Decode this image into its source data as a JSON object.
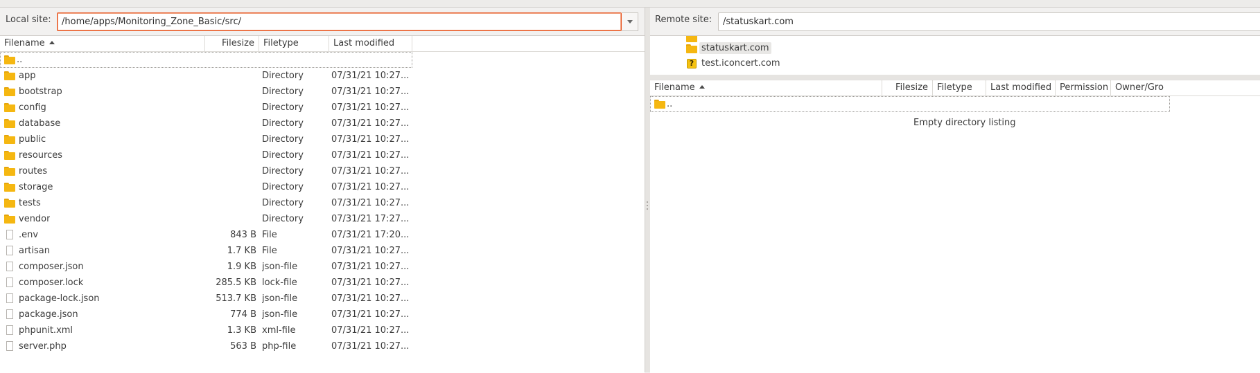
{
  "local": {
    "label": "Local site:",
    "path": "/home/apps/Monitoring_Zone_Basic/src/",
    "columns": [
      "Filename",
      "Filesize",
      "Filetype",
      "Last modified"
    ],
    "parent": "..",
    "rows": [
      {
        "name": "app",
        "size": "",
        "type": "Directory",
        "modified": "07/31/21 10:27...",
        "kind": "folder"
      },
      {
        "name": "bootstrap",
        "size": "",
        "type": "Directory",
        "modified": "07/31/21 10:27...",
        "kind": "folder"
      },
      {
        "name": "config",
        "size": "",
        "type": "Directory",
        "modified": "07/31/21 10:27...",
        "kind": "folder"
      },
      {
        "name": "database",
        "size": "",
        "type": "Directory",
        "modified": "07/31/21 10:27...",
        "kind": "folder"
      },
      {
        "name": "public",
        "size": "",
        "type": "Directory",
        "modified": "07/31/21 10:27...",
        "kind": "folder"
      },
      {
        "name": "resources",
        "size": "",
        "type": "Directory",
        "modified": "07/31/21 10:27...",
        "kind": "folder"
      },
      {
        "name": "routes",
        "size": "",
        "type": "Directory",
        "modified": "07/31/21 10:27...",
        "kind": "folder"
      },
      {
        "name": "storage",
        "size": "",
        "type": "Directory",
        "modified": "07/31/21 10:27...",
        "kind": "folder"
      },
      {
        "name": "tests",
        "size": "",
        "type": "Directory",
        "modified": "07/31/21 10:27...",
        "kind": "folder"
      },
      {
        "name": "vendor",
        "size": "",
        "type": "Directory",
        "modified": "07/31/21 17:27...",
        "kind": "folder"
      },
      {
        "name": ".env",
        "size": "843 B",
        "type": "File",
        "modified": "07/31/21 17:20...",
        "kind": "file"
      },
      {
        "name": "artisan",
        "size": "1.7 KB",
        "type": "File",
        "modified": "07/31/21 10:27...",
        "kind": "file"
      },
      {
        "name": "composer.json",
        "size": "1.9 KB",
        "type": "json-file",
        "modified": "07/31/21 10:27...",
        "kind": "file"
      },
      {
        "name": "composer.lock",
        "size": "285.5 KB",
        "type": "lock-file",
        "modified": "07/31/21 10:27...",
        "kind": "file"
      },
      {
        "name": "package-lock.json",
        "size": "513.7 KB",
        "type": "json-file",
        "modified": "07/31/21 10:27...",
        "kind": "file"
      },
      {
        "name": "package.json",
        "size": "774 B",
        "type": "json-file",
        "modified": "07/31/21 10:27...",
        "kind": "file"
      },
      {
        "name": "phpunit.xml",
        "size": "1.3 KB",
        "type": "xml-file",
        "modified": "07/31/21 10:27...",
        "kind": "file"
      },
      {
        "name": "server.php",
        "size": "563 B",
        "type": "php-file",
        "modified": "07/31/21 10:27...",
        "kind": "file"
      }
    ]
  },
  "remote": {
    "label": "Remote site:",
    "path": "/statuskart.com",
    "tree": [
      {
        "name": "statuskart.com",
        "icon": "folder-icon",
        "selected": true
      },
      {
        "name": "test.iconcert.com",
        "icon": "question-icon",
        "selected": false
      }
    ],
    "columns": [
      "Filename",
      "Filesize",
      "Filetype",
      "Last modified",
      "Permission",
      "Owner/Gro"
    ],
    "parent": "..",
    "empty_message": "Empty directory listing"
  },
  "colors": {
    "accent": "#e95420",
    "folder": "#f5b711",
    "background": "#f2f1f0"
  }
}
